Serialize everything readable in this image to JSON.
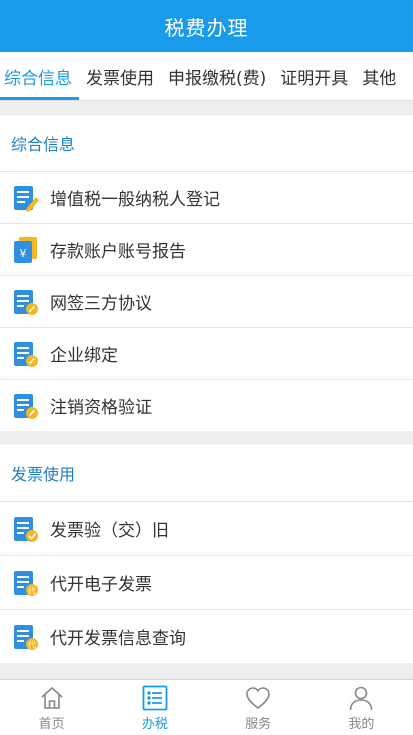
{
  "header": {
    "title": "税费办理"
  },
  "tabs": [
    {
      "label": "综合信息",
      "active": true
    },
    {
      "label": "发票使用",
      "active": false
    },
    {
      "label": "申报缴税(费)",
      "active": false
    },
    {
      "label": "证明开具",
      "active": false
    },
    {
      "label": "其他",
      "active": false
    }
  ],
  "sections": [
    {
      "title": "综合信息",
      "items": [
        {
          "label": "增值税一般纳税人登记",
          "icon": "document-edit-icon"
        },
        {
          "label": "存款账户账号报告",
          "icon": "yuan-account-icon"
        },
        {
          "label": "网签三方协议",
          "icon": "document-link-icon"
        },
        {
          "label": "企业绑定",
          "icon": "document-link-icon"
        },
        {
          "label": "注销资格验证",
          "icon": "document-link-icon"
        }
      ]
    },
    {
      "title": "发票使用",
      "items": [
        {
          "label": "发票验（交）旧",
          "icon": "document-check-icon"
        },
        {
          "label": "代开电子发票",
          "icon": "document-proxy-icon",
          "badge": "代"
        },
        {
          "label": "代开发票信息查询",
          "icon": "document-proxy-icon",
          "badge": "代"
        }
      ]
    }
  ],
  "bottom_nav": [
    {
      "label": "首页",
      "icon": "home-icon",
      "active": false
    },
    {
      "label": "办税",
      "icon": "list-icon",
      "active": true
    },
    {
      "label": "服务",
      "icon": "heart-icon",
      "active": false
    },
    {
      "label": "我的",
      "icon": "user-icon",
      "active": false
    }
  ],
  "colors": {
    "brand": "#1a9bea",
    "section_title": "#1f7fc6",
    "icon_badge": "#f5b623"
  }
}
